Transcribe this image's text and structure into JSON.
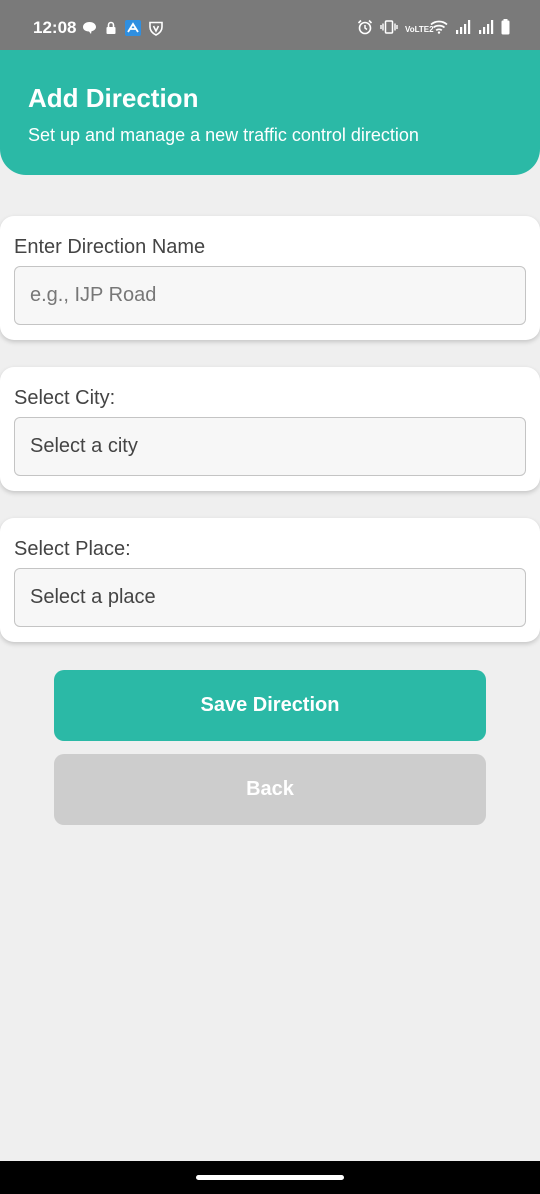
{
  "status_bar": {
    "time": "12:08",
    "network_label": "VoLTE2",
    "icons_left": [
      "chat-bubble-icon",
      "lock-icon",
      "app-notification-icon",
      "shield-icon"
    ],
    "icons_right": [
      "alarm-icon",
      "vibrate-icon",
      "volte-icon",
      "wifi-icon",
      "signal-icon",
      "signal-icon",
      "battery-icon"
    ]
  },
  "header": {
    "title": "Add Direction",
    "subtitle": "Set up and manage a new traffic control direction"
  },
  "form": {
    "direction_name": {
      "label": "Enter Direction Name",
      "placeholder": "e.g., IJP Road",
      "value": ""
    },
    "city": {
      "label": "Select City:",
      "selected": "Select a city"
    },
    "place": {
      "label": "Select Place:",
      "selected": "Select a place"
    }
  },
  "actions": {
    "save_label": "Save Direction",
    "back_label": "Back"
  },
  "colors": {
    "primary": "#2bb9a6",
    "disabled": "#cdcdcd",
    "background": "#efefef"
  }
}
